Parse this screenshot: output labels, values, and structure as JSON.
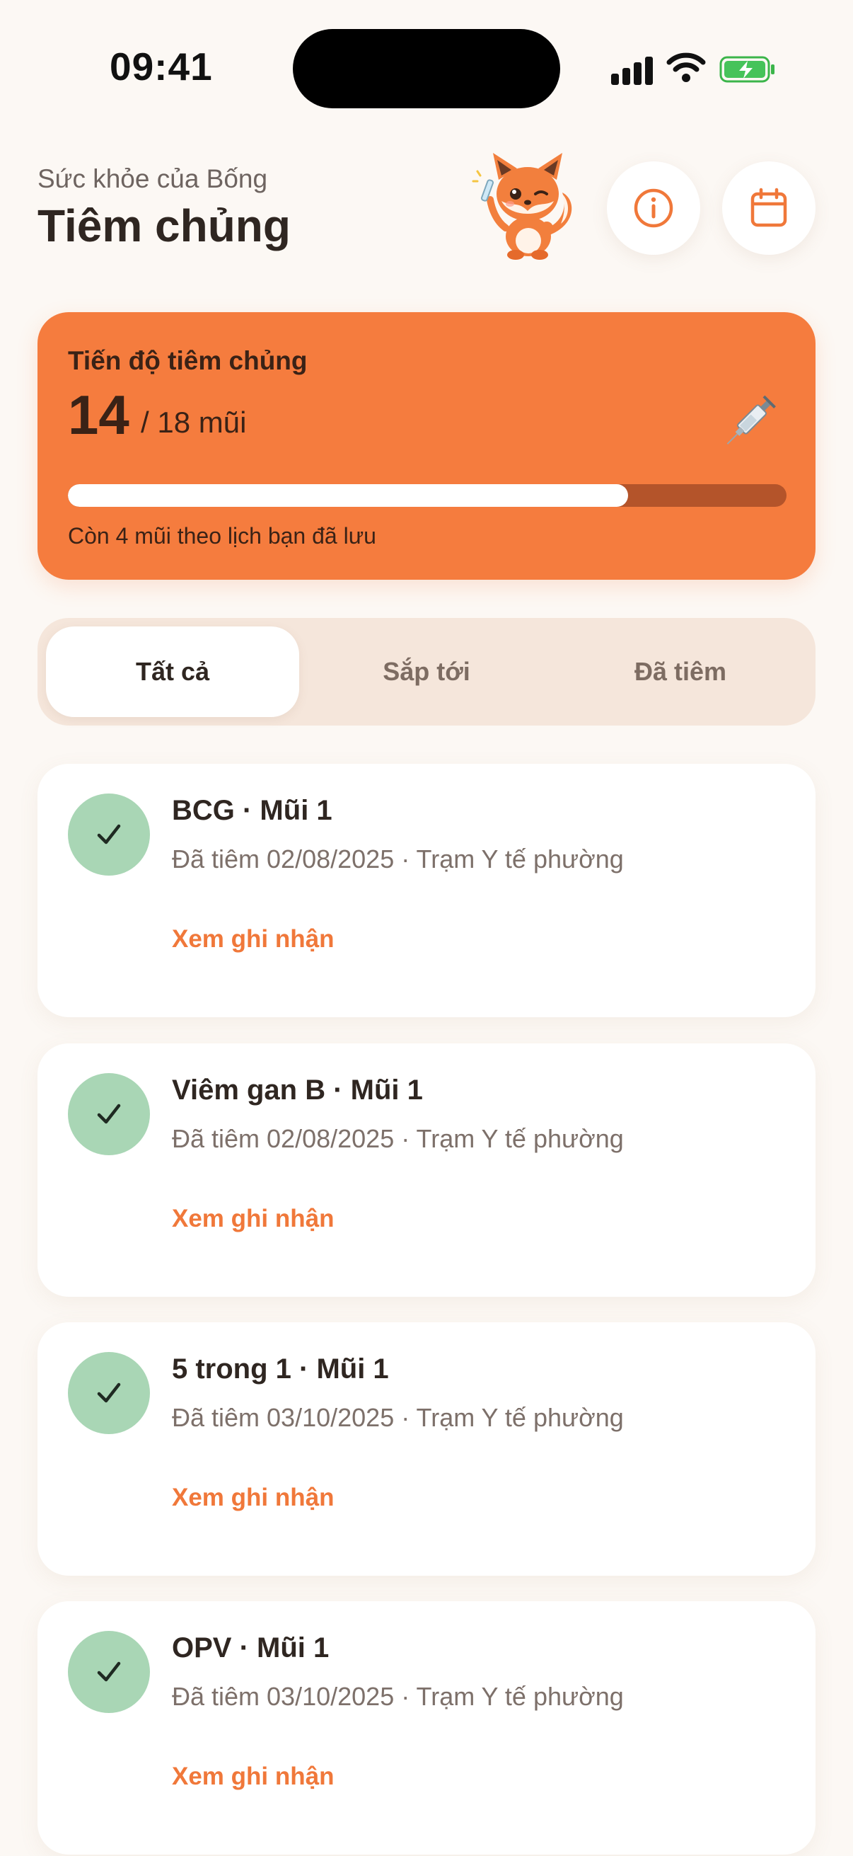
{
  "status_bar": {
    "time": "09:41"
  },
  "header": {
    "subtitle": "Sức khỏe của Bống",
    "title": "Tiêm chủng",
    "icons": [
      "fox-mascot",
      "info-icon",
      "calendar-icon"
    ]
  },
  "progress": {
    "label": "Tiến độ tiêm chủng",
    "count": "14",
    "total": "/ 18 mũi",
    "fraction": 0.78,
    "note": "Còn 4 mũi theo lịch bạn đã lưu",
    "accent": "#f57c3e"
  },
  "tabs": [
    {
      "label": "Tất cả",
      "active": true
    },
    {
      "label": "Sắp tới",
      "active": false
    },
    {
      "label": "Đã tiêm",
      "active": false
    }
  ],
  "vaccines": [
    {
      "title": "BCG · Mũi 1",
      "subtitle": "Đã tiêm 02/08/2025 · Trạm Y tế phường",
      "link": "Xem ghi nhận"
    },
    {
      "title": "Viêm gan B · Mũi 1",
      "subtitle": "Đã tiêm 02/08/2025 · Trạm Y tế phường",
      "link": "Xem ghi nhận"
    },
    {
      "title": "5 trong 1 · Mũi 1",
      "subtitle": "Đã tiêm 03/10/2025 · Trạm Y tế phường",
      "link": "Xem ghi nhận"
    },
    {
      "title": "OPV · Mũi 1",
      "subtitle": "Đã tiêm 03/10/2025 · Trạm Y tế phường",
      "link": "Xem ghi nhận"
    }
  ],
  "colors": {
    "background": "#fcf8f4",
    "done": "#a9d6b5",
    "link": "#f0783a"
  }
}
